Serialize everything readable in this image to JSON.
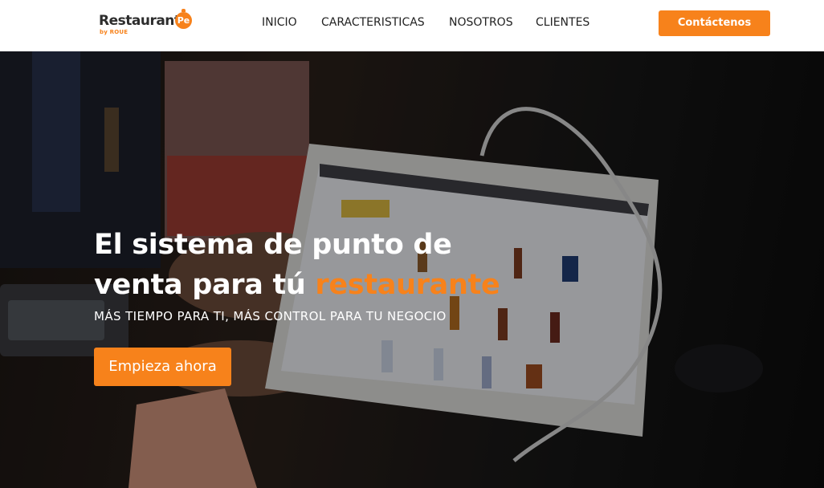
{
  "brand": {
    "name": "Restaurant",
    "badge": "Pe",
    "sub": "by ROUE"
  },
  "nav": {
    "links": [
      "INICIO",
      "CARACTERISTICAS",
      "NOSOTROS",
      "CLIENTES"
    ],
    "contact_button": "Contáctenos"
  },
  "hero": {
    "title_line1": "El sistema de punto de",
    "title_line2_prefix": "venta para tú",
    "title_accent": "restaurante",
    "subtitle": "MÁS TIEMPO PARA TI, MÁS CONTROL PARA TU NEGOCIO",
    "cta_button": "Empieza ahora"
  },
  "colors": {
    "accent": "#f7821b",
    "nav_bg": "#ffffff",
    "nav_text": "#222222",
    "hero_text": "#ffffff"
  },
  "icons": {
    "logo": "restaurant-pe-logo"
  }
}
